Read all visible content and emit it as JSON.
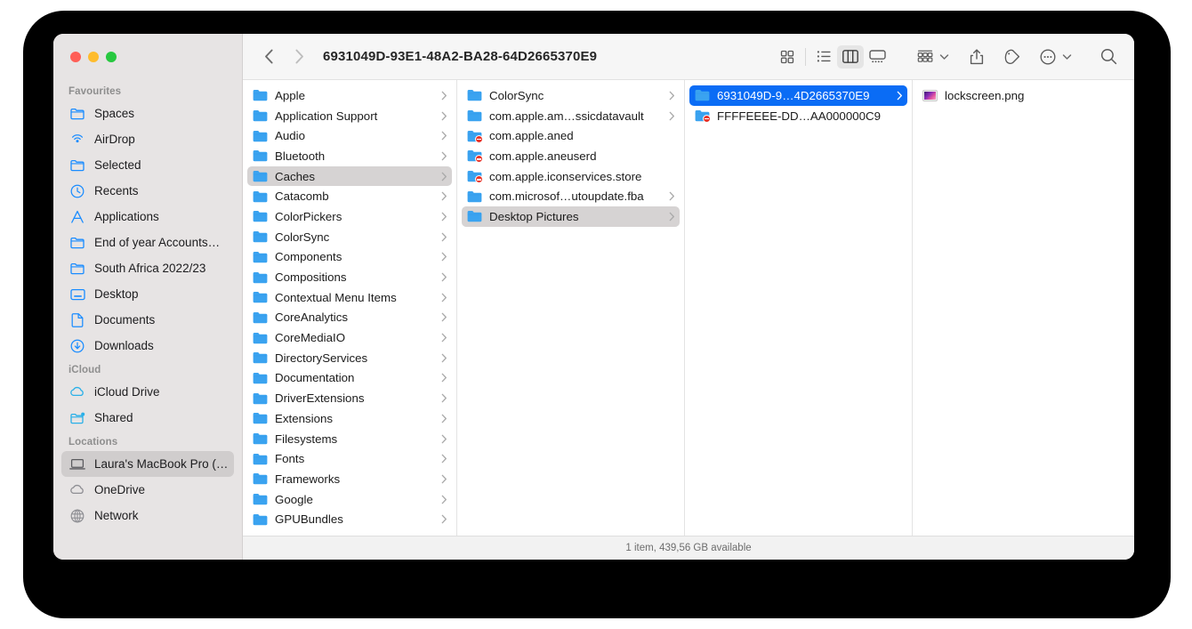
{
  "window": {
    "title": "6931049D-93E1-48A2-BA28-64D2665370E9",
    "traffic_lights": [
      "close",
      "minimize",
      "zoom"
    ],
    "status": "1 item, 439,56 GB available"
  },
  "toolbar": {
    "back_label": "Back",
    "forward_label": "Forward",
    "view_icon_grid": "grid-view-icon",
    "view_icon_list": "list-view-icon",
    "view_icon_column": "column-view-icon",
    "view_icon_gallery": "gallery-view-icon",
    "group_label": "Group",
    "share_label": "Share",
    "tag_label": "Tags",
    "more_label": "More",
    "search_label": "Search",
    "active_view": "column"
  },
  "sidebar": {
    "groups": [
      {
        "title": "Favourites",
        "items": [
          {
            "label": "Spaces",
            "icon": "folder-icon",
            "selected": false
          },
          {
            "label": "AirDrop",
            "icon": "airdrop-icon",
            "selected": false
          },
          {
            "label": "Selected",
            "icon": "folder-icon",
            "selected": false
          },
          {
            "label": "Recents",
            "icon": "clock-icon",
            "selected": false
          },
          {
            "label": "Applications",
            "icon": "applications-icon",
            "selected": false
          },
          {
            "label": "End of year Accounts…",
            "icon": "folder-icon",
            "selected": false
          },
          {
            "label": "South Africa 2022/23",
            "icon": "folder-icon",
            "selected": false
          },
          {
            "label": "Desktop",
            "icon": "desktop-icon",
            "selected": false
          },
          {
            "label": "Documents",
            "icon": "document-icon",
            "selected": false
          },
          {
            "label": "Downloads",
            "icon": "downloads-icon",
            "selected": false
          }
        ]
      },
      {
        "title": "iCloud",
        "items": [
          {
            "label": "iCloud Drive",
            "icon": "cloud-icon",
            "selected": false
          },
          {
            "label": "Shared",
            "icon": "shared-folder-icon",
            "selected": false
          }
        ]
      },
      {
        "title": "Locations",
        "items": [
          {
            "label": "Laura's MacBook Pro (…",
            "icon": "laptop-icon",
            "selected": true
          },
          {
            "label": "OneDrive",
            "icon": "cloud-gray-icon",
            "selected": false
          },
          {
            "label": "Network",
            "icon": "globe-icon",
            "selected": false
          }
        ]
      }
    ]
  },
  "columns": [
    {
      "name": "column-1",
      "rows": [
        {
          "label": "Apple",
          "icon": "folder-icon",
          "chevron": true,
          "state": "none"
        },
        {
          "label": "Application Support",
          "icon": "folder-icon",
          "chevron": true,
          "state": "none"
        },
        {
          "label": "Audio",
          "icon": "folder-icon",
          "chevron": true,
          "state": "none"
        },
        {
          "label": "Bluetooth",
          "icon": "folder-icon",
          "chevron": true,
          "state": "none"
        },
        {
          "label": "Caches",
          "icon": "folder-icon",
          "chevron": true,
          "state": "gray"
        },
        {
          "label": "Catacomb",
          "icon": "folder-icon",
          "chevron": true,
          "state": "none"
        },
        {
          "label": "ColorPickers",
          "icon": "folder-icon",
          "chevron": true,
          "state": "none"
        },
        {
          "label": "ColorSync",
          "icon": "folder-icon",
          "chevron": true,
          "state": "none"
        },
        {
          "label": "Components",
          "icon": "folder-icon",
          "chevron": true,
          "state": "none"
        },
        {
          "label": "Compositions",
          "icon": "folder-icon",
          "chevron": true,
          "state": "none"
        },
        {
          "label": "Contextual Menu Items",
          "icon": "folder-icon",
          "chevron": true,
          "state": "none"
        },
        {
          "label": "CoreAnalytics",
          "icon": "folder-icon",
          "chevron": true,
          "state": "none"
        },
        {
          "label": "CoreMediaIO",
          "icon": "folder-icon",
          "chevron": true,
          "state": "none"
        },
        {
          "label": "DirectoryServices",
          "icon": "folder-icon",
          "chevron": true,
          "state": "none"
        },
        {
          "label": "Documentation",
          "icon": "folder-icon",
          "chevron": true,
          "state": "none"
        },
        {
          "label": "DriverExtensions",
          "icon": "folder-icon",
          "chevron": true,
          "state": "none"
        },
        {
          "label": "Extensions",
          "icon": "folder-icon",
          "chevron": true,
          "state": "none"
        },
        {
          "label": "Filesystems",
          "icon": "folder-icon",
          "chevron": true,
          "state": "none"
        },
        {
          "label": "Fonts",
          "icon": "folder-icon",
          "chevron": true,
          "state": "none"
        },
        {
          "label": "Frameworks",
          "icon": "folder-icon",
          "chevron": true,
          "state": "none"
        },
        {
          "label": "Google",
          "icon": "folder-icon",
          "chevron": true,
          "state": "none"
        },
        {
          "label": "GPUBundles",
          "icon": "folder-icon",
          "chevron": true,
          "state": "none"
        }
      ]
    },
    {
      "name": "column-2",
      "rows": [
        {
          "label": "ColorSync",
          "icon": "folder-icon",
          "chevron": true,
          "state": "none"
        },
        {
          "label": "com.apple.am…ssicdatavault",
          "icon": "folder-icon",
          "chevron": true,
          "state": "none"
        },
        {
          "label": "com.apple.aned",
          "icon": "folder-noaccess-icon",
          "chevron": false,
          "state": "none"
        },
        {
          "label": "com.apple.aneuserd",
          "icon": "folder-noaccess-icon",
          "chevron": false,
          "state": "none"
        },
        {
          "label": "com.apple.iconservices.store",
          "icon": "folder-noaccess-icon",
          "chevron": false,
          "state": "none"
        },
        {
          "label": "com.microsof…utoupdate.fba",
          "icon": "folder-icon",
          "chevron": true,
          "state": "none"
        },
        {
          "label": "Desktop Pictures",
          "icon": "folder-icon",
          "chevron": true,
          "state": "gray"
        }
      ]
    },
    {
      "name": "column-3",
      "rows": [
        {
          "label": "6931049D-9…4D2665370E9",
          "icon": "folder-icon",
          "chevron": true,
          "state": "blue"
        },
        {
          "label": "FFFFEEEE-DD…AA000000C9",
          "icon": "folder-noaccess-icon",
          "chevron": false,
          "state": "none"
        }
      ]
    },
    {
      "name": "column-4",
      "rows": [
        {
          "label": "lockscreen.png",
          "icon": "image-thumbnail-icon",
          "chevron": false,
          "state": "none"
        }
      ]
    }
  ]
}
